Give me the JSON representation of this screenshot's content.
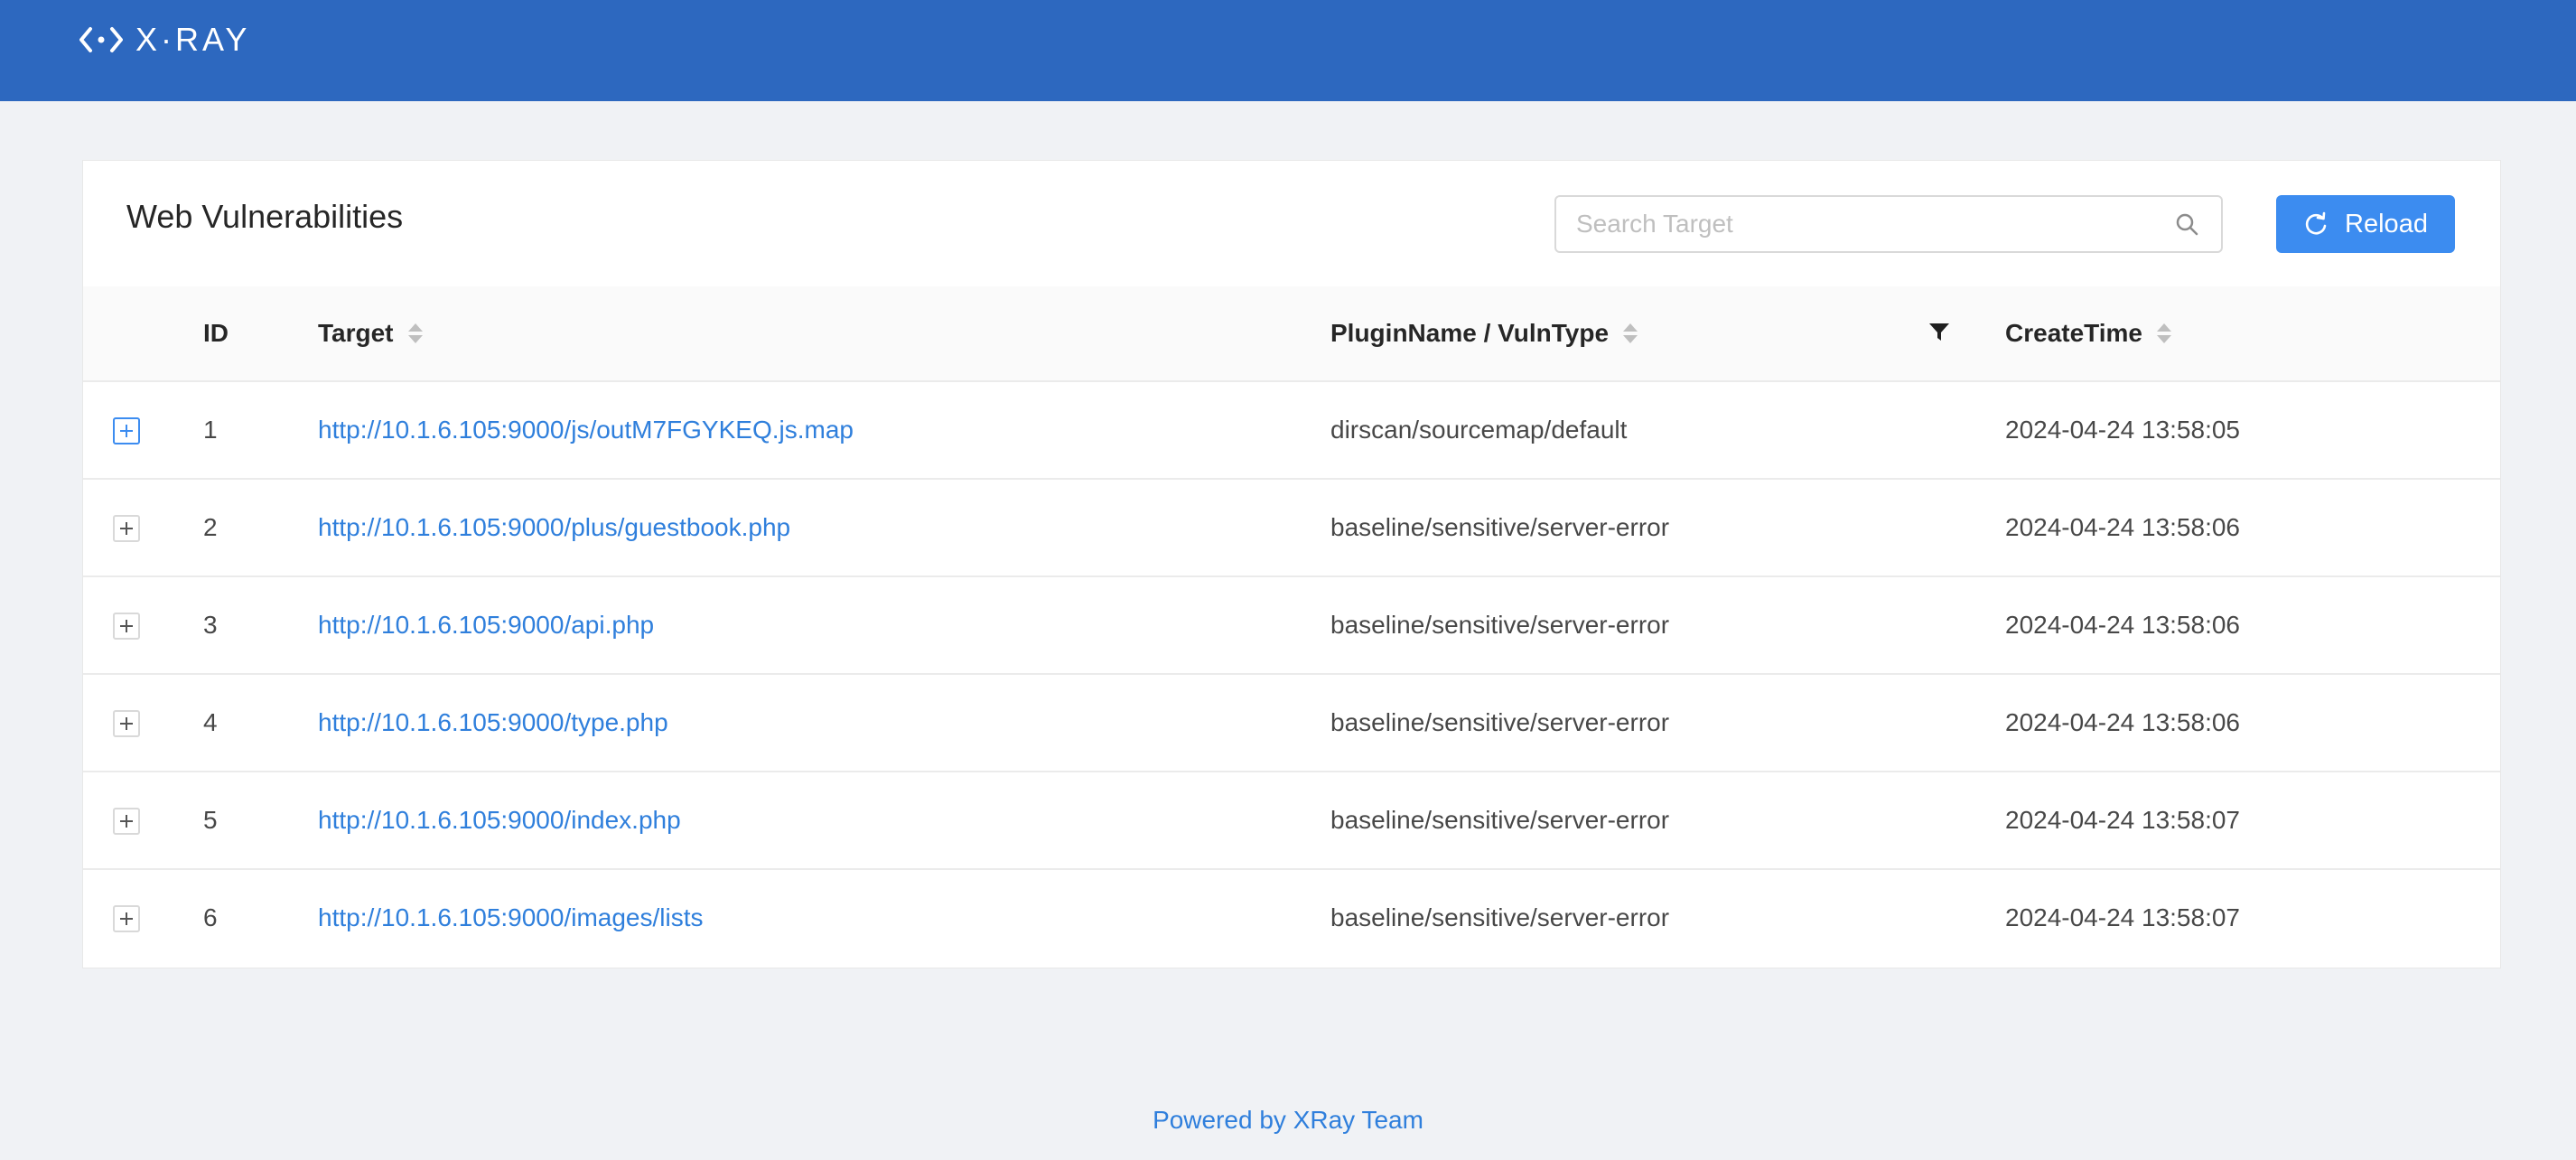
{
  "header": {
    "logo_text": "X·RAY",
    "logo_icon": "xray-logo-icon",
    "background": "#2d68bf"
  },
  "card": {
    "title": "Web Vulnerabilities",
    "search": {
      "placeholder": "Search Target",
      "value": ""
    },
    "reload_label": "Reload",
    "accent": "#3c8cf0"
  },
  "table": {
    "columns": {
      "id": "ID",
      "target": "Target",
      "plugin": "PluginName / VulnType",
      "create_time": "CreateTime"
    },
    "rows": [
      {
        "id": "1",
        "target": "http://10.1.6.105:9000/js/outM7FGYKEQ.js.map",
        "plugin": "dirscan/sourcemap/default",
        "create_time": "2024-04-24 13:58:05"
      },
      {
        "id": "2",
        "target": "http://10.1.6.105:9000/plus/guestbook.php",
        "plugin": "baseline/sensitive/server-error",
        "create_time": "2024-04-24 13:58:06"
      },
      {
        "id": "3",
        "target": "http://10.1.6.105:9000/api.php",
        "plugin": "baseline/sensitive/server-error",
        "create_time": "2024-04-24 13:58:06"
      },
      {
        "id": "4",
        "target": "http://10.1.6.105:9000/type.php",
        "plugin": "baseline/sensitive/server-error",
        "create_time": "2024-04-24 13:58:06"
      },
      {
        "id": "5",
        "target": "http://10.1.6.105:9000/index.php",
        "plugin": "baseline/sensitive/server-error",
        "create_time": "2024-04-24 13:58:07"
      },
      {
        "id": "6",
        "target": "http://10.1.6.105:9000/images/lists",
        "plugin": "baseline/sensitive/server-error",
        "create_time": "2024-04-24 13:58:07"
      }
    ]
  },
  "footer": {
    "text": "Powered by XRay Team"
  }
}
